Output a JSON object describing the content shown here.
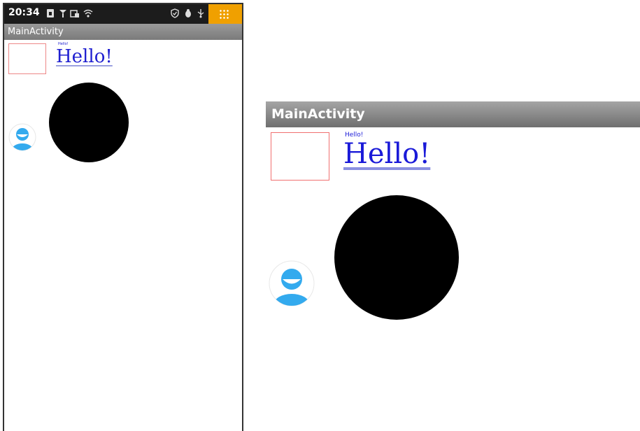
{
  "phone": {
    "status_bar": {
      "time": "20:34",
      "icons": [
        "sim-icon",
        "signal-icon",
        "storage-icon",
        "wifi-icon",
        "shield-icon",
        "bug-icon",
        "usb-icon",
        "grid-menu-icon"
      ],
      "accent_color": "#f0a000"
    },
    "app_title": "MainActivity",
    "content": {
      "small_hello": "Hello!",
      "big_hello": "Hello!",
      "link_color": "#2020d0",
      "box_border_color": "#ee8888",
      "circle_color": "#000000",
      "avatar_color": "#33aaee"
    }
  },
  "zoom": {
    "app_title": "MainActivity",
    "content": {
      "small_hello": "Hello!",
      "big_hello": "Hello!"
    }
  }
}
